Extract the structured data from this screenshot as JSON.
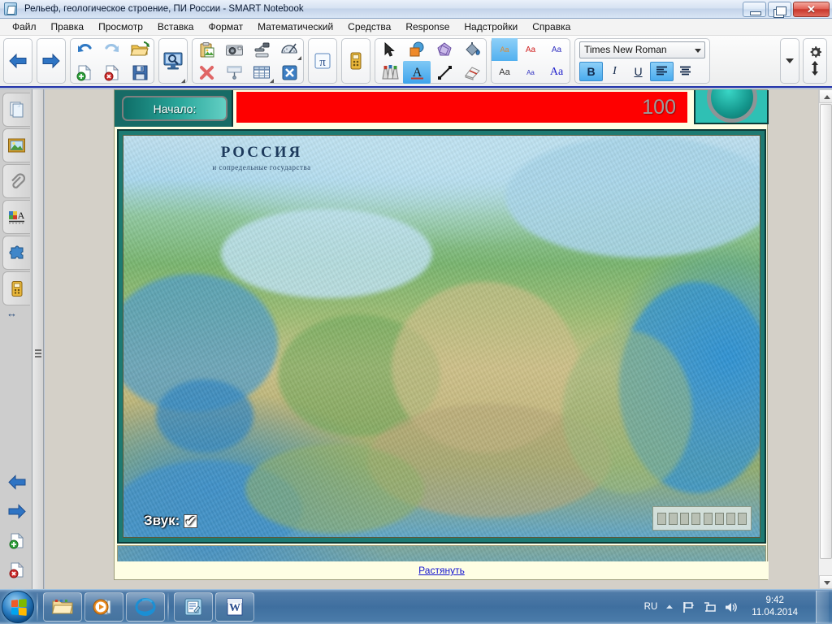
{
  "window": {
    "title": "Рельеф, геологическое строение, ПИ России - SMART Notebook",
    "app_icon": "smart-notebook-icon",
    "minimize_label": "—",
    "restore_label": "❐",
    "close_label": "✕"
  },
  "menu": {
    "items": [
      {
        "label": "Файл"
      },
      {
        "label": "Правка"
      },
      {
        "label": "Просмотр"
      },
      {
        "label": "Вставка"
      },
      {
        "label": "Формат"
      },
      {
        "label": "Математический"
      },
      {
        "label": "Средства"
      },
      {
        "label": "Response"
      },
      {
        "label": "Надстройки"
      },
      {
        "label": "Справка"
      }
    ]
  },
  "toolbar": {
    "nav": [
      {
        "name": "previous-page-button",
        "icon": "arrow-left-icon"
      },
      {
        "name": "next-page-button",
        "icon": "arrow-right-icon"
      }
    ],
    "file_group": [
      {
        "name": "undo-button",
        "icon": "undo-icon"
      },
      {
        "name": "redo-button",
        "icon": "redo-icon"
      },
      {
        "name": "open-button",
        "icon": "open-folder-icon"
      },
      {
        "name": "add-page-button",
        "icon": "page-add-icon"
      },
      {
        "name": "delete-page-button",
        "icon": "page-delete-icon"
      },
      {
        "name": "save-button",
        "icon": "floppy-save-icon"
      }
    ],
    "screen_group": [
      {
        "name": "screen-shade-button",
        "icon": "screen-magnify-icon"
      }
    ],
    "insert_group": [
      {
        "name": "paste-button",
        "icon": "clipboard-paste-icon"
      },
      {
        "name": "screen-capture-button",
        "icon": "camera-icon"
      },
      {
        "name": "document-camera-button",
        "icon": "doc-camera-icon"
      },
      {
        "name": "measurement-tools-button",
        "icon": "protractor-icon"
      },
      {
        "name": "delete-button",
        "icon": "red-x-icon"
      },
      {
        "name": "screen-shade-toggle-button",
        "icon": "blind-icon"
      },
      {
        "name": "insert-table-button",
        "icon": "table-icon"
      },
      {
        "name": "full-screen-button",
        "icon": "fullscreen-icon"
      }
    ],
    "math_group": [
      {
        "name": "math-tools-button",
        "icon": "pi-icon"
      }
    ],
    "response_group": [
      {
        "name": "response-button",
        "icon": "clicker-icon"
      }
    ],
    "tools_group": [
      {
        "name": "select-tool-button",
        "icon": "cursor-arrow-icon",
        "selected": false
      },
      {
        "name": "shapes-tool-button",
        "icon": "shapes-icon",
        "selected": false
      },
      {
        "name": "polygon-tool-button",
        "icon": "polygon-icon",
        "selected": false
      },
      {
        "name": "fill-tool-button",
        "icon": "paint-bucket-icon",
        "selected": false
      },
      {
        "name": "pens-tool-button",
        "icon": "pens-icon",
        "selected": false
      },
      {
        "name": "text-tool-button",
        "icon": "text-a-icon",
        "selected": true
      },
      {
        "name": "line-tool-button",
        "icon": "line-icon",
        "selected": false
      },
      {
        "name": "eraser-tool-button",
        "icon": "eraser-icon",
        "selected": false
      }
    ],
    "style_group": [
      {
        "name": "style-swatch-1",
        "label": "Aa",
        "selected": true
      },
      {
        "name": "style-swatch-2",
        "label": "Aa",
        "selected": false
      },
      {
        "name": "style-swatch-3",
        "label": "Aa",
        "selected": false
      },
      {
        "name": "style-swatch-4",
        "label": "Aa",
        "selected": false
      },
      {
        "name": "style-swatch-5",
        "label": "Aa",
        "selected": false
      },
      {
        "name": "style-swatch-6",
        "label": "Aa",
        "selected": false
      }
    ],
    "font": {
      "selected_family": "Times New Roman",
      "bold_label": "B",
      "italic_label": "I",
      "underline_label": "U",
      "align_left_label": "≡",
      "align_center_label": "≡",
      "bold_on": true,
      "italic_on": false,
      "underline_on": false,
      "align_left_on": true
    },
    "overflow_label": "▼",
    "customize_icon": "gear-icon",
    "move_toolbar_icon": "move-vertical-icon"
  },
  "sidebar": {
    "tabs": [
      {
        "name": "sidebar-tab-page-sorter",
        "icon": "pages-icon"
      },
      {
        "name": "sidebar-tab-gallery",
        "icon": "gallery-picture-icon"
      },
      {
        "name": "sidebar-tab-attachments",
        "icon": "paperclip-icon"
      },
      {
        "name": "sidebar-tab-properties",
        "icon": "properties-icon"
      },
      {
        "name": "sidebar-tab-addons",
        "icon": "puzzle-icon"
      },
      {
        "name": "sidebar-tab-response",
        "icon": "clicker-icon"
      }
    ],
    "bottom": [
      {
        "name": "sidebar-prev-button",
        "icon": "arrow-left-icon"
      },
      {
        "name": "sidebar-next-button",
        "icon": "arrow-right-icon"
      },
      {
        "name": "sidebar-add-page-button",
        "icon": "page-add-icon"
      },
      {
        "name": "sidebar-delete-page-button",
        "icon": "page-delete-icon"
      }
    ],
    "resize_icon": "resize-horizontal-icon"
  },
  "page": {
    "start_button_label": "Начало:",
    "score_value": "100",
    "sound_label": "Звук:",
    "sound_checked": true,
    "sound_check_glyph": "✔",
    "stretch_link_label": "Растянуть",
    "map": {
      "title": "РОССИЯ",
      "subtitle": "и сопредельные государства"
    },
    "colors": {
      "banner_red": "#fe0000",
      "frame_teal": "#1d7a72",
      "button_teal": "#2aa79b",
      "page_cream": "#fefee4",
      "score_gray": "#9c9c9c",
      "link_blue": "#1414cf"
    }
  },
  "taskbar": {
    "start_icon": "windows-orb-icon",
    "buttons": [
      {
        "name": "taskbar-explorer-button",
        "icon": "folder-icon"
      },
      {
        "name": "taskbar-media-player-button",
        "icon": "media-player-icon"
      },
      {
        "name": "taskbar-internet-explorer-button",
        "icon": "internet-explorer-icon"
      },
      {
        "name": "taskbar-smart-notebook-button",
        "icon": "smart-notebook-icon"
      },
      {
        "name": "taskbar-word-button",
        "icon": "word-icon"
      }
    ],
    "tray": {
      "language": "RU",
      "show_hidden_icon": "chevron-up-icon",
      "icons": [
        {
          "name": "tray-action-center-icon",
          "icon": "flag-icon"
        },
        {
          "name": "tray-network-icon",
          "icon": "network-icon"
        },
        {
          "name": "tray-volume-icon",
          "icon": "speaker-icon"
        }
      ],
      "time": "9:42",
      "date": "11.04.2014"
    }
  }
}
